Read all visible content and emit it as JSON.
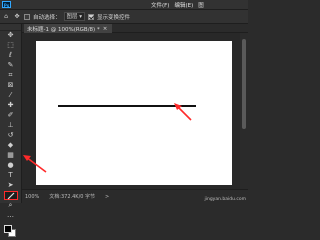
{
  "menu": [
    "文件(F)",
    "编辑(E)",
    "图"
  ],
  "logo_text": "Ps",
  "options": {
    "auto_select_label": "自动选择：",
    "layer_select": "图层",
    "show_transform_label": "显示变换控件"
  },
  "document": {
    "tab_title": "未标题-1 @ 100%(RGB/8) *",
    "close": "×"
  },
  "status": {
    "zoom": "100%",
    "doc_info": "文档:372.4K/0 字节",
    "arrow": ">"
  },
  "watermark": "jingyan.baidu.com",
  "tools": [
    "move-tool",
    "marquee-tool",
    "lasso-tool",
    "quick-select-tool",
    "crop-tool",
    "frame-tool",
    "eyedropper-tool",
    "healing-brush-tool",
    "brush-tool",
    "clone-stamp-tool",
    "history-brush-tool",
    "eraser-tool",
    "gradient-tool",
    "blur-tool",
    "dodge-tool",
    "type-tool",
    "path-select-tool",
    "rectangle-tool",
    "line-tool",
    "hand-tool",
    "zoom-tool"
  ],
  "colors": {
    "foreground": "#000000",
    "background": "#ffffff",
    "highlight": "#ff2a2a"
  }
}
